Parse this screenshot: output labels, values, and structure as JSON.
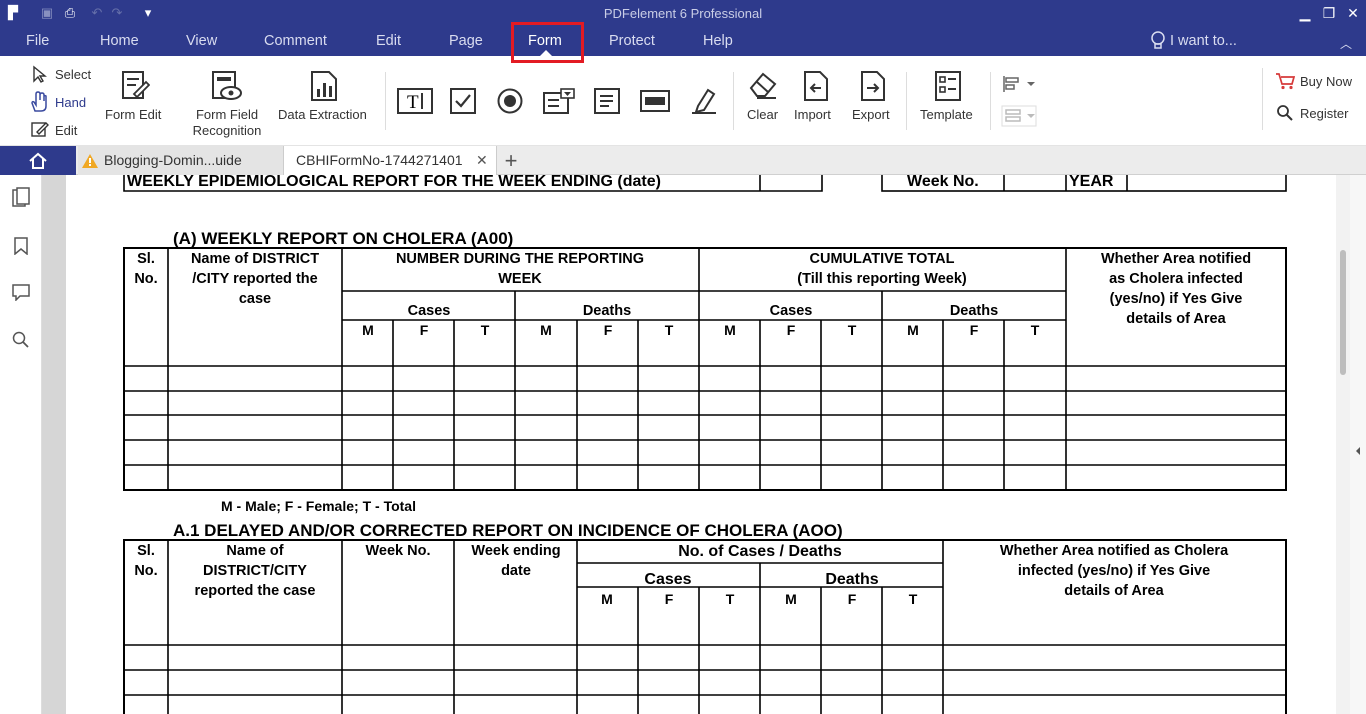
{
  "app": {
    "title": "PDFelement 6 Professional"
  },
  "menu": {
    "items": [
      "File",
      "Home",
      "View",
      "Comment",
      "Edit",
      "Page",
      "Form",
      "Protect",
      "Help"
    ],
    "active": "Form",
    "search_placeholder": "I want to..."
  },
  "toolbar": {
    "select": "Select",
    "hand": "Hand",
    "edit": "Edit",
    "form_edit": "Form Edit",
    "form_field_line1": "Form Field",
    "form_field_line2": "Recognition",
    "data_extraction": "Data Extraction",
    "clear": "Clear",
    "import": "Import",
    "export": "Export",
    "template": "Template",
    "buy_now": "Buy Now",
    "register": "Register"
  },
  "tabs": [
    {
      "label": "Blogging-Domin...uide",
      "warning": true
    },
    {
      "label": "CBHIFormNo-1744271401",
      "active": true
    }
  ],
  "doc": {
    "header_line": "WEEKLY EPIDEMIOLOGICAL REPORT  FOR THE WEEK ENDING (date)",
    "week_no": "Week No.",
    "year": "YEAR",
    "sectionA": "(A) WEEKLY REPORT ON CHOLERA (A00)",
    "slno": [
      "Sl.",
      "No."
    ],
    "district_name": [
      "Name of DISTRICT",
      "/CITY reported the",
      "case"
    ],
    "number_during": [
      "NUMBER DURING THE REPORTING",
      "WEEK"
    ],
    "cumulative": [
      "CUMULATIVE TOTAL",
      "(Till this reporting Week)"
    ],
    "whether1": [
      "Whether Area notified",
      "as Cholera  infected",
      "(yes/no)      if Yes Give",
      "details of Area"
    ],
    "cases": "Cases",
    "deaths": "Deaths",
    "mft": [
      "M",
      "F",
      "T"
    ],
    "legend": "M - Male;  F - Female;  T - Total",
    "sectionA1": "A.1 DELAYED AND/OR CORRECTED REPORT ON INCIDENCE OF CHOLERA (AOO)",
    "name_district2": [
      "Name of",
      "DISTRICT/CITY",
      "reported the case"
    ],
    "week_no2": "Week No.",
    "week_ending": [
      "Week ending",
      "date"
    ],
    "no_cases_deaths": "No. of Cases / Deaths",
    "whether2": [
      "Whether Area notified as Cholera",
      "infected (yes/no)      if Yes Give",
      "details of Area"
    ]
  },
  "colors": {
    "accent": "#2e3a8c",
    "highlight": "#e31b23",
    "icon": "#3a4a9f"
  }
}
